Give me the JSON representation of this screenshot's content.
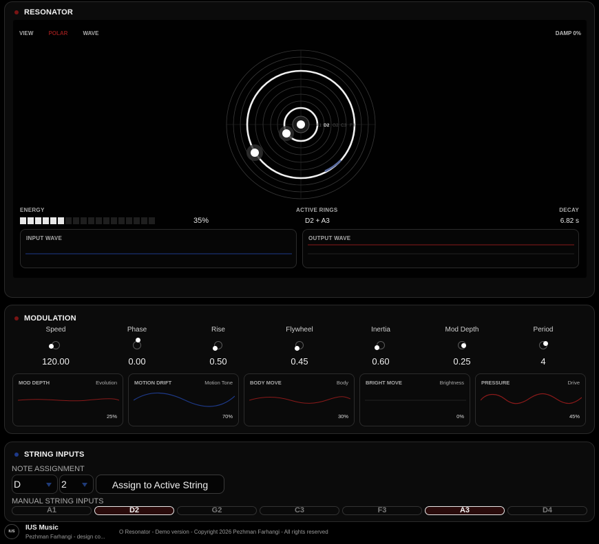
{
  "resonator": {
    "title": "RESONATOR",
    "accent_dot": "#7a1414",
    "view_tabs": [
      "VIEW",
      "POLAR",
      "WAVE"
    ],
    "active_view": "POLAR",
    "damp": "DAMP 0%",
    "polar_ring_labels": [
      "A1",
      "D2",
      "G2",
      "C3",
      "F3"
    ],
    "energy": {
      "label": "ENERGY",
      "value": "35%",
      "level": 0.35,
      "segments_on": 6,
      "segments_total": 18
    },
    "active_rings": {
      "label": "ACTIVE RINGS",
      "value": "D2 + A3"
    },
    "decay": {
      "label": "DECAY",
      "value": "6.82 s"
    },
    "input_wave": {
      "label": "INPUT WAVE",
      "color": "#1e3a8a"
    },
    "output_wave": {
      "label": "OUTPUT WAVE",
      "color": "#8b1a1a"
    }
  },
  "modulation": {
    "title": "MODULATION",
    "accent_dot": "#7a1414",
    "knobs": [
      {
        "label": "Speed",
        "value": "120.00"
      },
      {
        "label": "Phase",
        "value": "0.00"
      },
      {
        "label": "Rise",
        "value": "0.50"
      },
      {
        "label": "Flywheel",
        "value": "0.45"
      },
      {
        "label": "Inertia",
        "value": "0.60"
      },
      {
        "label": "Mod Depth",
        "value": "0.25"
      },
      {
        "label": "Period",
        "value": "4"
      }
    ],
    "cards": [
      {
        "label": "MOD DEPTH",
        "right": "Evolution",
        "percent": "25%",
        "color": "#8b1a1a"
      },
      {
        "label": "MOTION DRIFT",
        "right": "Motion Tone",
        "percent": "70%",
        "color": "#1e3a8a"
      },
      {
        "label": "BODY MOVE",
        "right": "Body",
        "percent": "30%",
        "color": "#8b1a1a"
      },
      {
        "label": "BRIGHT MOVE",
        "right": "Brightness",
        "percent": "0%",
        "color": "#2a2a2a"
      },
      {
        "label": "PRESSURE",
        "right": "Drive",
        "percent": "45%",
        "color": "#8b1a1a"
      }
    ]
  },
  "strings": {
    "title": "STRING INPUTS",
    "accent_dot": "#1e3a8a",
    "note_assignment_label": "NOTE ASSIGNMENT",
    "note_select": "D",
    "octave_select": "2",
    "assign_button": "Assign to Active String",
    "manual_label": "MANUAL STRING INPUTS",
    "buttons": [
      "A1",
      "D2",
      "G2",
      "C3",
      "F3",
      "A3",
      "D4"
    ],
    "active": [
      "D2",
      "A3"
    ]
  },
  "footer": {
    "logo": "IUS",
    "brand": "IUS Music",
    "subtitle": "Pezhman Farhangi - design co...",
    "copyright": "O Resonator - Demo version - Copyright 2026 Pezhman Farhangi - All rights reserved"
  }
}
